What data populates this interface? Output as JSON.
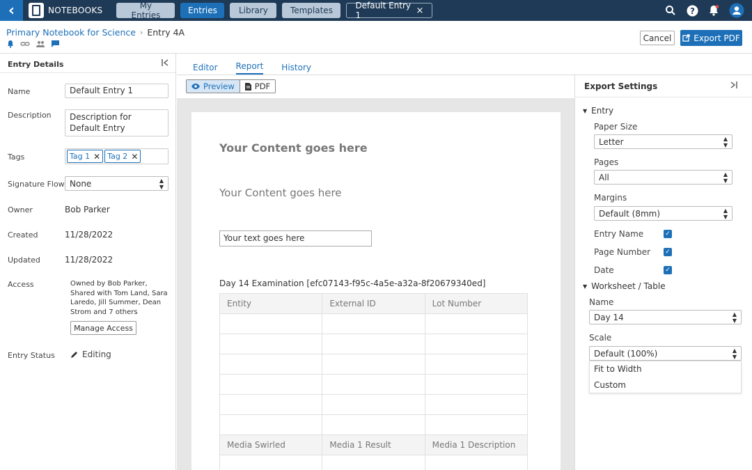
{
  "topbar": {
    "brand": "NOTEBOOKS",
    "nav": [
      "My Entries",
      "Entries",
      "Library",
      "Templates"
    ],
    "open_tab": "Default Entry 1",
    "close": "×",
    "colors": {
      "bar": "#1f3a56",
      "accent": "#1d70b8"
    }
  },
  "header": {
    "breadcrumb_parent": "Primary Notebook for Science",
    "breadcrumb_sep": "›",
    "breadcrumb_current": "Entry 4A",
    "cancel": "Cancel",
    "export_pdf": "Export PDF"
  },
  "entry_details": {
    "title": "Entry Details",
    "labels": {
      "name": "Name",
      "description": "Description",
      "tags": "Tags",
      "signature_flow": "Signature Flow",
      "owner": "Owner",
      "created": "Created",
      "updated": "Updated",
      "access": "Access",
      "entry_status": "Entry Status"
    },
    "name": "Default Entry 1",
    "description": "Description for Default Entry",
    "tags": [
      "Tag 1",
      "Tag 2"
    ],
    "signature_flow": "None",
    "owner": "Bob Parker",
    "created": "11/28/2022",
    "updated": "11/28/2022",
    "access_text": "Owned by Bob Parker, Shared with Tom Land, Sara Laredo, Jill Summer, Dean Strom and 7 others",
    "manage_access": "Manage Access",
    "status": "Editing"
  },
  "tabs": [
    "Editor",
    "Report",
    "History"
  ],
  "view_toggle": {
    "preview": "Preview",
    "pdf": "PDF"
  },
  "document": {
    "heading1": "Your Content goes here",
    "heading2": "Your Content goes here",
    "text_field": "Your text goes here",
    "table_title": "Day 14 Examination [efc07143-f95c-4a5e-a32a-8f20679340ed]",
    "headers1": [
      "Entity",
      "External ID",
      "Lot Number"
    ],
    "headers2": [
      "Media Swirled",
      "Media 1 Result",
      "Media 1 Description"
    ]
  },
  "export_settings": {
    "title": "Export Settings",
    "entry_section": "Entry",
    "paper_size_label": "Paper Size",
    "paper_size": "Letter",
    "pages_label": "Pages",
    "pages": "All",
    "margins_label": "Margins",
    "margins": "Default (8mm)",
    "entry_name_label": "Entry Name",
    "page_number_label": "Page Number",
    "date_label": "Date",
    "worksheet_section": "Worksheet / Table",
    "name_label": "Name",
    "name": "Day 14",
    "scale_label": "Scale",
    "scale": "Default (100%)",
    "scale_options": [
      "Fit to Width",
      "Custom"
    ]
  }
}
